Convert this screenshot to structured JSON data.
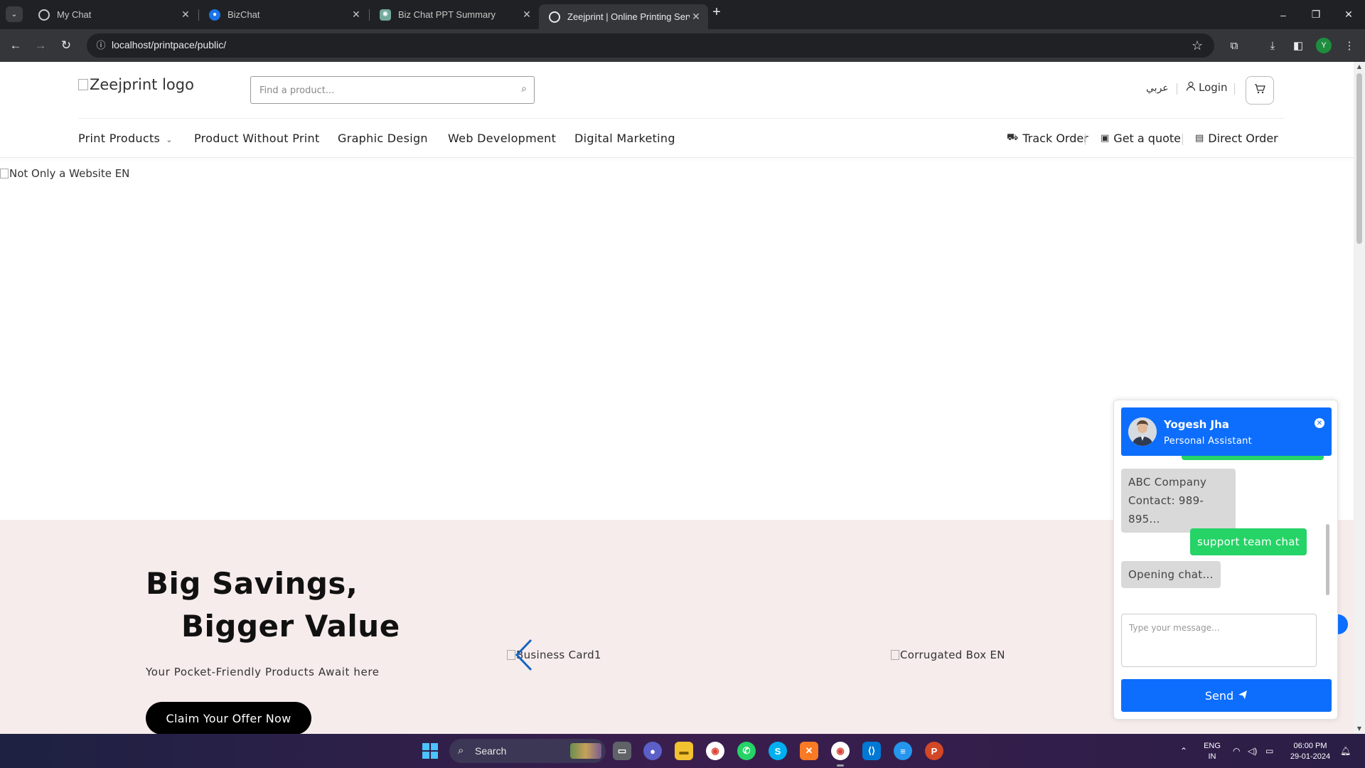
{
  "browser": {
    "tabs": [
      {
        "title": "My Chat",
        "active": false
      },
      {
        "title": "BizChat",
        "active": false
      },
      {
        "title": "Biz Chat PPT Summary",
        "active": false
      },
      {
        "title": "Zeejprint | Online Printing Servic",
        "active": true
      }
    ],
    "new_tab": "+",
    "window_controls": {
      "minimize": "–",
      "restore": "❐",
      "close": "✕"
    },
    "url": "localhost/printpace/public/",
    "profile_initial": "Y"
  },
  "site": {
    "logo_alt": "Zeejprint logo",
    "search_placeholder": "Find a product...",
    "lang_switch": "عربي",
    "login": "Login",
    "nav": [
      "Print Products",
      "Product Without Print",
      "Graphic Design",
      "Web Development",
      "Digital Marketing"
    ],
    "right_nav": [
      "Track Order",
      "Get a quote",
      "Direct Order"
    ],
    "banner_alt": "Not Only a Website EN",
    "promo": {
      "title_line1": "Big Savings,",
      "title_line2": "Bigger Value",
      "subtitle": "Your Pocket-Friendly Products Await here",
      "cta": "Claim Your Offer Now",
      "items": [
        "Business Card1",
        "Corrugated Box EN"
      ]
    }
  },
  "chat": {
    "agent_name": "Yogesh Jha",
    "agent_role": "Personal Assistant",
    "messages": [
      {
        "from": "bot",
        "lines": [
          "ABC Company",
          "Contact: 989-895..."
        ]
      },
      {
        "from": "user",
        "text": "support team chat"
      },
      {
        "from": "bot",
        "text": "Opening chat..."
      }
    ],
    "input_placeholder": "Type your message...",
    "send_label": "Send"
  },
  "taskbar": {
    "search_label": "Search",
    "lang_top": "ENG",
    "lang_bottom": "IN",
    "time": "06:00 PM",
    "date": "29-01-2024"
  },
  "colors": {
    "accent_blue": "#0d6efd",
    "chat_green": "#25d366",
    "promo_bg": "#f7ecec",
    "browser_dark": "#202124"
  }
}
